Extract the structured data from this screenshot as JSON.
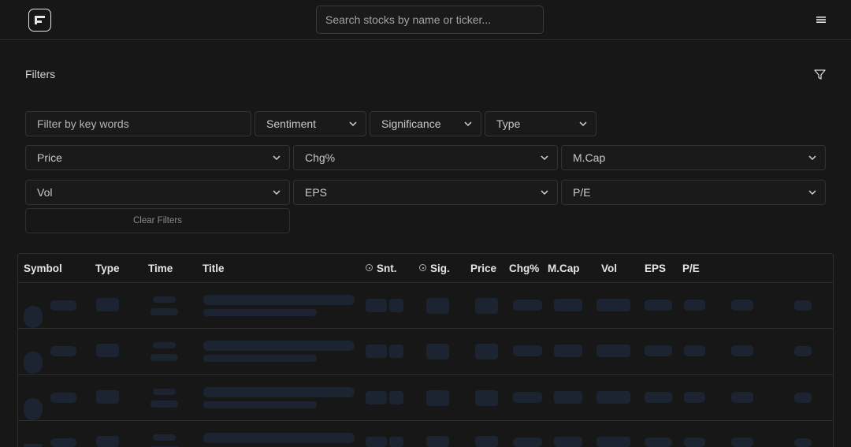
{
  "header": {
    "search_placeholder": "Search stocks by name or ticker..."
  },
  "filters": {
    "title": "Filters",
    "keyword_placeholder": "Filter by key words",
    "dropdowns": {
      "sentiment": "Sentiment",
      "significance": "Significance",
      "type": "Type",
      "price": "Price",
      "chg": "Chg%",
      "mcap": "M.Cap",
      "vol": "Vol",
      "eps": "EPS",
      "pe": "P/E"
    },
    "clear_label": "Clear Filters"
  },
  "table": {
    "columns": {
      "symbol": "Symbol",
      "type": "Type",
      "time": "Time",
      "title": "Title",
      "snt": "Snt.",
      "sig": "Sig.",
      "price": "Price",
      "chg": "Chg%",
      "mcap": "M.Cap",
      "vol": "Vol",
      "eps": "EPS",
      "pe": "P/E"
    },
    "loading_rows": 4
  },
  "colors": {
    "background": "#171717",
    "border": "#2e2e2e",
    "skeleton": "#1c2431",
    "text": "#e5e5e5"
  },
  "icons": [
    "app-logo-icon",
    "hamburger-menu-icon",
    "filter-funnel-icon",
    "chevron-down-icon",
    "info-circle-icon"
  ]
}
